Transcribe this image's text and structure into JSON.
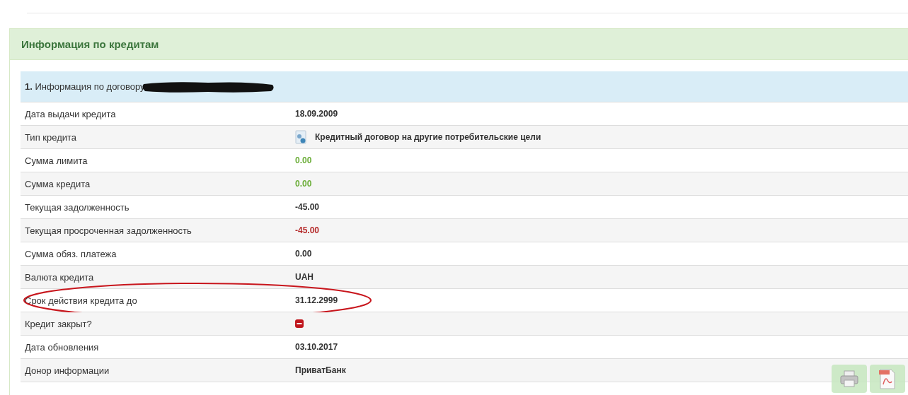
{
  "panel": {
    "title": "Информация по кредитам"
  },
  "contract": {
    "number": "1.",
    "label": "Информация по договору",
    "redacted": true
  },
  "rows": [
    {
      "kind": "text",
      "label": "Дата выдачи кредита",
      "value": "18.09.2009",
      "color": "#333333",
      "highlighted": false
    },
    {
      "kind": "icon-text",
      "label": "Тип кредита",
      "value": "Кредитный договор на другие потребительские цели",
      "color": "#333333",
      "highlighted": false
    },
    {
      "kind": "text",
      "label": "Сумма лимита",
      "value": "0.00",
      "color": "#6cae3a",
      "highlighted": false
    },
    {
      "kind": "text",
      "label": "Сумма кредита",
      "value": "0.00",
      "color": "#6cae3a",
      "highlighted": false
    },
    {
      "kind": "text",
      "label": "Текущая задолженность",
      "value": "-45.00",
      "color": "#333333",
      "highlighted": false
    },
    {
      "kind": "text",
      "label": "Текущая просроченная задолженность",
      "value": "-45.00",
      "color": "#b52b2b",
      "highlighted": false
    },
    {
      "kind": "text",
      "label": "Сумма обяз. платежа",
      "value": "0.00",
      "color": "#333333",
      "highlighted": false
    },
    {
      "kind": "text",
      "label": "Валюта кредита",
      "value": "UAH",
      "color": "#333333",
      "highlighted": false
    },
    {
      "kind": "text",
      "label": "Срок действия кредита до",
      "value": "31.12.2999",
      "color": "#333333",
      "highlighted": true
    },
    {
      "kind": "flag",
      "label": "Кредит закрыт?",
      "closed": false,
      "highlighted": false
    },
    {
      "kind": "text",
      "label": "Дата обновления",
      "value": "03.10.2017",
      "color": "#333333",
      "highlighted": false
    },
    {
      "kind": "text",
      "label": "Донор информации",
      "value": "ПриватБанк",
      "color": "#333333",
      "highlighted": false
    }
  ]
}
